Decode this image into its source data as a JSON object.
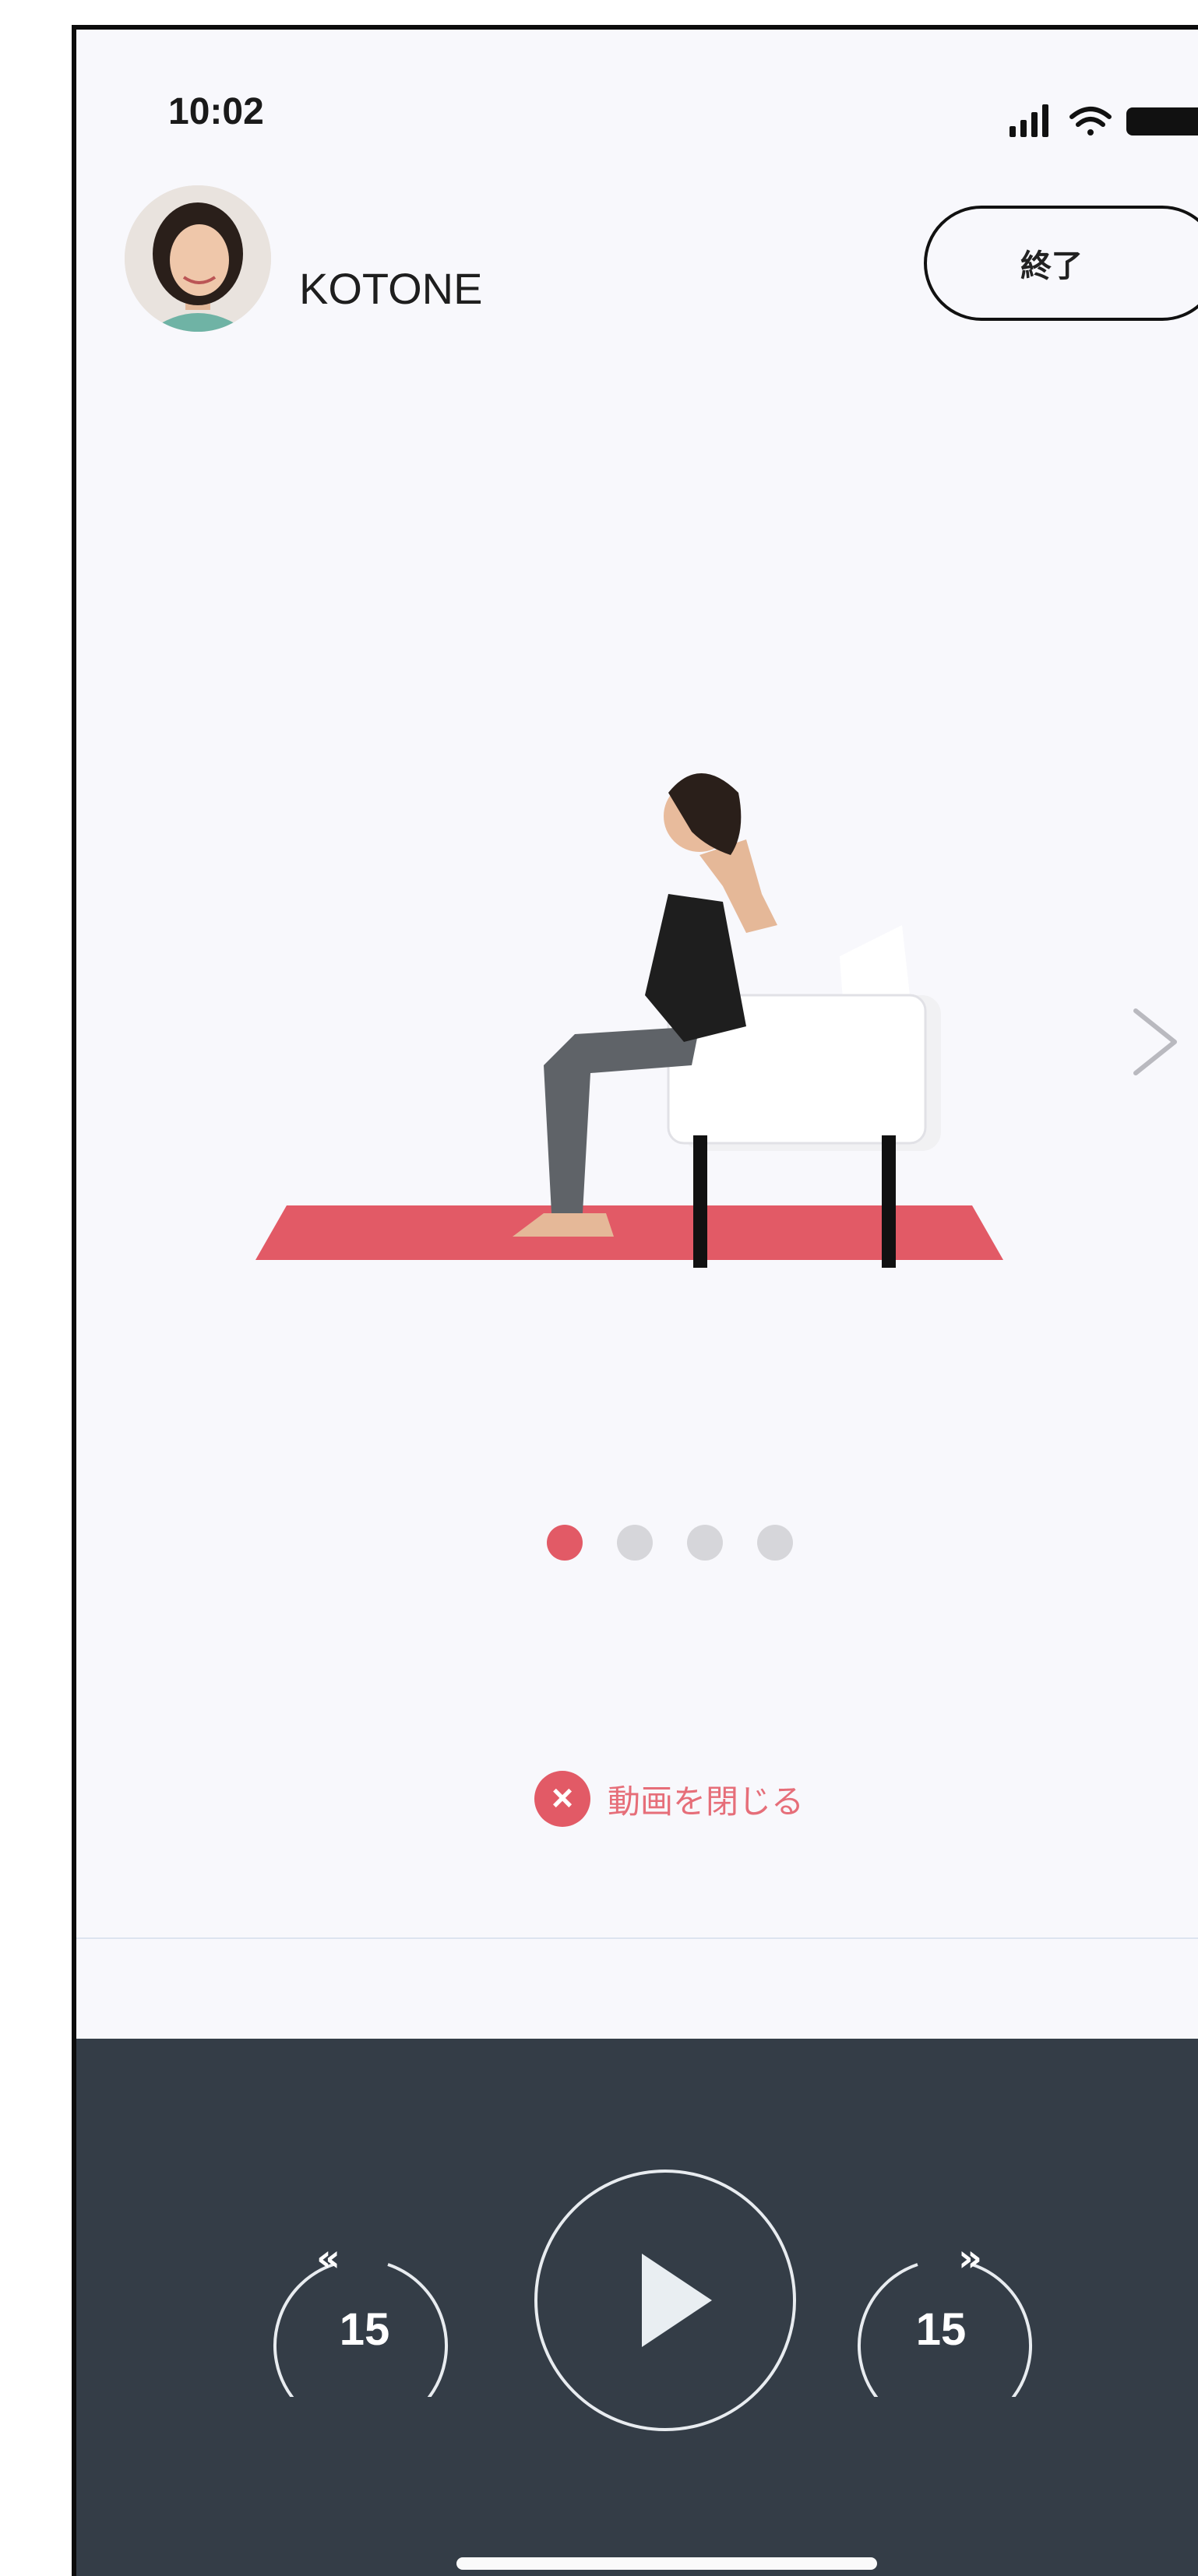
{
  "status_bar": {
    "time": "10:02"
  },
  "header": {
    "instructor_name": "KOTONE",
    "end_button_label": "終了"
  },
  "carousel": {
    "page_count": 4,
    "current_page": 1
  },
  "close_video": {
    "label": "動画を閉じる"
  },
  "player": {
    "rewind_seconds": "15",
    "forward_seconds": "15",
    "play_state": "paused"
  },
  "colors": {
    "accent": "#e25a66",
    "player_bg": "#343d47",
    "background": "#f8f8fc",
    "mat": "#e25a66"
  },
  "icons": {
    "rewind": "rewind-15-icon",
    "forward": "forward-15-icon",
    "play": "play-icon",
    "next": "chevron-right-icon",
    "close": "close-circle-icon"
  }
}
